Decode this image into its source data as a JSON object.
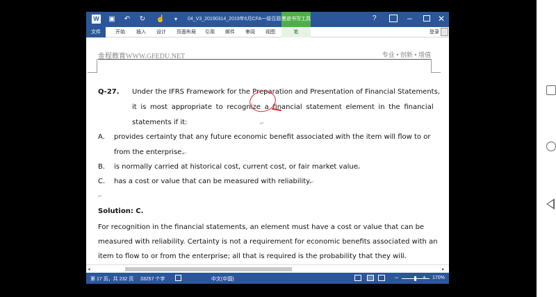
{
  "titlebar": {
    "document_title": "04_V3_20190314_2019年6月CFA一级百题班...",
    "help": "?",
    "context_tab_title": "墨迹书写工具"
  },
  "ribbon": {
    "tabs": [
      "文件",
      "开始",
      "插入",
      "设计",
      "页面布局",
      "引用",
      "邮件",
      "审阅",
      "视图",
      "笔"
    ],
    "login": "登录"
  },
  "page": {
    "header_left": "金程教育WWW.GFEDU.NET",
    "header_right": "专业 • 创新 • 增值",
    "question_number": "Q-27.",
    "question_line1": "Under the IFRS Framework for the Preparation and Presentation of Financial Statements,",
    "question_line2": "it is most appropriate to recognize a financial statement element in the financial",
    "question_line3": "statements if it:",
    "options": [
      {
        "letter": "A.",
        "line1": "provides certainty that any future economic benefit associated with the item will flow to or",
        "line2": "from the enterprise."
      },
      {
        "letter": "B.",
        "line1": "is normally carried at historical cost, current cost, or fair market value."
      },
      {
        "letter": "C.",
        "line1": "has a cost or value that can be measured with reliability."
      }
    ],
    "solution_label": "Solution: C.",
    "solution_line1": "For recognition in the financial statements, an element must have a cost or value that can be",
    "solution_line2": "measured with reliability. Certainty is not a requirement for economic benefits associated with an",
    "solution_line3": "item to flow to or from the enterprise; all that is required is the probability that they will.",
    "return_mark": "↵"
  },
  "statusbar": {
    "page_info": "第 17 页，共 232 页",
    "word_count": "33257 个字",
    "language": "中文(中国)",
    "zoom": "170%"
  }
}
